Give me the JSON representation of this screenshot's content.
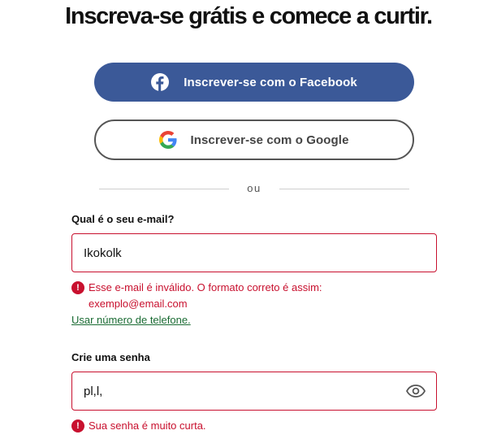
{
  "heading": "Inscreva-se grátis e comece a curtir.",
  "social": {
    "facebook_label": "Inscrever-se com o Facebook",
    "facebook_icon": "facebook-icon",
    "facebook_color": "#3b5998",
    "google_label": "Inscrever-se com o Google",
    "google_icon": "google-icon"
  },
  "divider_text": "ou",
  "email": {
    "label": "Qual é o seu e-mail?",
    "value": "Ikokolk",
    "error": "Esse e-mail é inválido. O formato correto é assim: exemplo@email.com"
  },
  "phone_link": "Usar número de telefone.",
  "password": {
    "label": "Crie uma senha",
    "value": "pl,l,",
    "toggle_icon": "eye-icon",
    "error": "Sua senha é muito curta."
  },
  "colors": {
    "error": "#c8102e",
    "link": "#1a6b33"
  }
}
